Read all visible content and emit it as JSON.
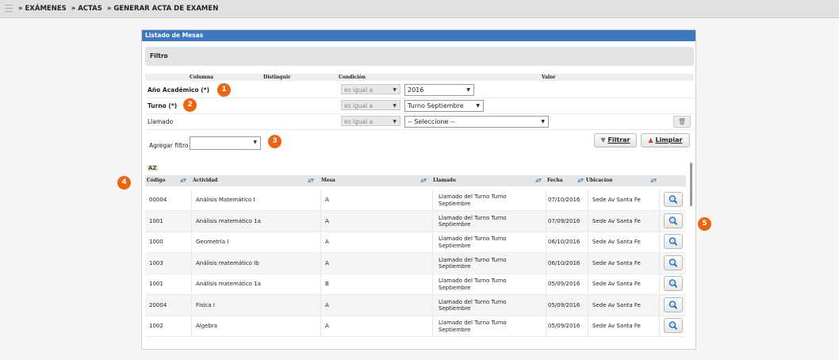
{
  "breadcrumb": {
    "items": [
      "EXÁMENES",
      "ACTAS",
      "GENERAR ACTA DE EXAMEN"
    ],
    "separator": "»"
  },
  "panel": {
    "title": "Listado de Mesas",
    "filter_title": "Filtro"
  },
  "filter_columns": {
    "columna": "Columna",
    "distinguir": "Distinguir",
    "condicion": "Condición",
    "valor": "Valor"
  },
  "filters": [
    {
      "label": "Año Académico (*)",
      "condition": "es igual a",
      "value": "2016"
    },
    {
      "label": "Turno (*)",
      "condition": "es igual a",
      "value": "Turno Septiembre"
    },
    {
      "label": "Llamado",
      "condition": "es igual a",
      "value": "-- Seleccione --"
    }
  ],
  "add_filter": {
    "label": "Agregar filtro",
    "value": ""
  },
  "buttons": {
    "filtrar": "Filtrar",
    "limpiar": "Limpiar"
  },
  "sort_icon_label": "AZ",
  "table": {
    "headers": [
      "Código",
      "Actividad",
      "Mesa",
      "Llamado",
      "Fecha",
      "Ubicacion"
    ],
    "rows": [
      {
        "codigo": "00004",
        "actividad": "Análisis Matemático I",
        "mesa": "A",
        "llamado_1": "Llamado del Turno Turno",
        "llamado_2": "Septiembre",
        "fecha": "07/10/2016",
        "ubicacion": "Sede Av Santa Fe"
      },
      {
        "codigo": "1001",
        "actividad": "Análisis matemático 1a",
        "mesa": "A",
        "llamado_1": "Llamado del Turno Turno",
        "llamado_2": "Septiembre",
        "fecha": "07/09/2016",
        "ubicacion": "Sede Av Santa Fe"
      },
      {
        "codigo": "1000",
        "actividad": "Geometría I",
        "mesa": "A",
        "llamado_1": "Llamado del Turno Turno",
        "llamado_2": "Septiembre",
        "fecha": "06/10/2016",
        "ubicacion": "Sede Av Santa Fe"
      },
      {
        "codigo": "1003",
        "actividad": "Análisis matemático Ib",
        "mesa": "A",
        "llamado_1": "Llamado del Turno Turno",
        "llamado_2": "Septiembre",
        "fecha": "06/10/2016",
        "ubicacion": "Sede Av Santa Fe"
      },
      {
        "codigo": "1001",
        "actividad": "Análisis matemático 1a",
        "mesa": "B",
        "llamado_1": "Llamado del Turno Turno",
        "llamado_2": "Septiembre",
        "fecha": "05/09/2016",
        "ubicacion": "Sede Av Santa Fe"
      },
      {
        "codigo": "20004",
        "actividad": "Física I",
        "mesa": "A",
        "llamado_1": "Llamado del Turno Turno",
        "llamado_2": "Septiembre",
        "fecha": "05/09/2016",
        "ubicacion": "Sede Av Santa Fe"
      },
      {
        "codigo": "1002",
        "actividad": "Álgebra",
        "mesa": "A",
        "llamado_1": "Llamado del Turno Turno",
        "llamado_2": "Septiembre",
        "fecha": "05/09/2016",
        "ubicacion": "Sede Av Santa Fe"
      }
    ]
  },
  "badges": [
    "1",
    "2",
    "3",
    "4",
    "5"
  ],
  "colors": {
    "header_blue": "#3f79bd",
    "badge_orange": "#f0620d"
  },
  "icons": {
    "menu": "menu-icon",
    "trash": "trash-icon",
    "filter": "filter-icon",
    "broom": "broom-icon",
    "magnifier": "magnifier-icon",
    "sort": "sort-az-icon"
  }
}
